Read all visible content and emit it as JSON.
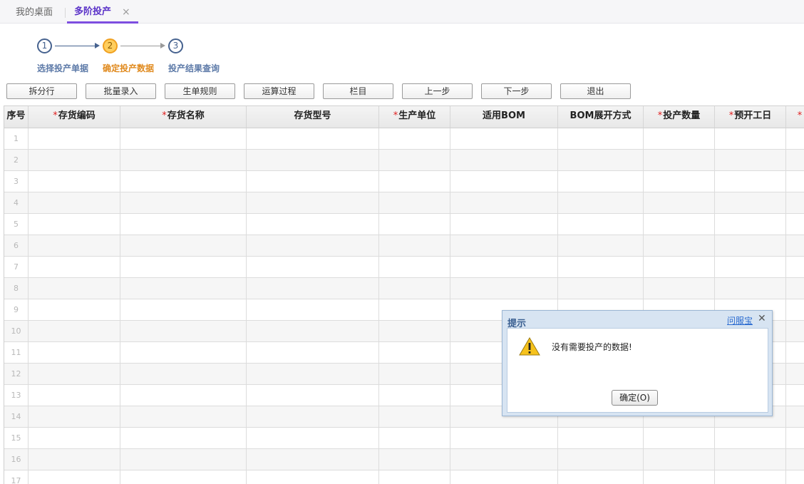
{
  "tabs": {
    "desktop": "我的桌面",
    "active": "多阶投产",
    "close_glyph": "×"
  },
  "wizard": {
    "steps": [
      {
        "num": "1",
        "label": "选择投产单据",
        "state": "done"
      },
      {
        "num": "2",
        "label": "确定投产数据",
        "state": "active"
      },
      {
        "num": "3",
        "label": "投产结果查询",
        "state": "todo"
      }
    ]
  },
  "toolbar": {
    "buttons": [
      "拆分行",
      "批量录入",
      "生单规则",
      "运算过程",
      "栏目",
      "上一步",
      "下一步",
      "退出"
    ]
  },
  "grid": {
    "columns": [
      {
        "label": "序号",
        "required": false
      },
      {
        "label": "存货编码",
        "required": true
      },
      {
        "label": "存货名称",
        "required": true
      },
      {
        "label": "存货型号",
        "required": false
      },
      {
        "label": "生产单位",
        "required": true
      },
      {
        "label": "适用BOM",
        "required": false
      },
      {
        "label": "BOM展开方式",
        "required": false
      },
      {
        "label": "投产数量",
        "required": true
      },
      {
        "label": "预开工日",
        "required": true
      },
      {
        "label": "",
        "required": true
      }
    ],
    "required_mark": "*",
    "row_numbers": [
      "1",
      "2",
      "3",
      "4",
      "5",
      "6",
      "7",
      "8",
      "9",
      "10",
      "11",
      "12",
      "13",
      "14",
      "15",
      "16",
      "17"
    ]
  },
  "dialog": {
    "title": "提示",
    "help_link": "问服宝",
    "close_glyph": "✕",
    "message": "没有需要投产的数据!",
    "ok_label": "确定(O)",
    "icon": "warning-icon"
  },
  "colors": {
    "accent": "#7d4ee0",
    "step_done": "#46628f",
    "step_active": "#f0a020",
    "required": "#e02020",
    "dialog_frame": "#d7e4f2"
  }
}
